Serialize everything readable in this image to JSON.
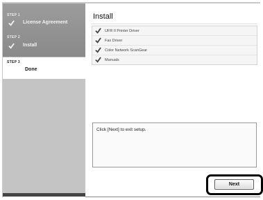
{
  "sidebar": {
    "steps": [
      {
        "step_label": "STEP 1",
        "name": "License Agreement",
        "done": true
      },
      {
        "step_label": "STEP 2",
        "name": "Install",
        "done": true
      },
      {
        "step_label": "STEP 3",
        "name": "Done",
        "done": false,
        "active": true
      }
    ]
  },
  "main": {
    "title": "Install",
    "items": [
      {
        "label": "UFR II Printer Driver",
        "icon": "check-icon"
      },
      {
        "label": "Fax Driver",
        "icon": "check-icon"
      },
      {
        "label": "Color Network ScanGear",
        "icon": "check-icon"
      },
      {
        "label": "Manuals",
        "icon": "check-icon"
      }
    ],
    "message": "Click [Next] to exit setup.",
    "next_label": "Next"
  },
  "colors": {
    "sidebar": "#c4c4c4",
    "active_step": "#ffffff",
    "highlight": "#000000"
  }
}
